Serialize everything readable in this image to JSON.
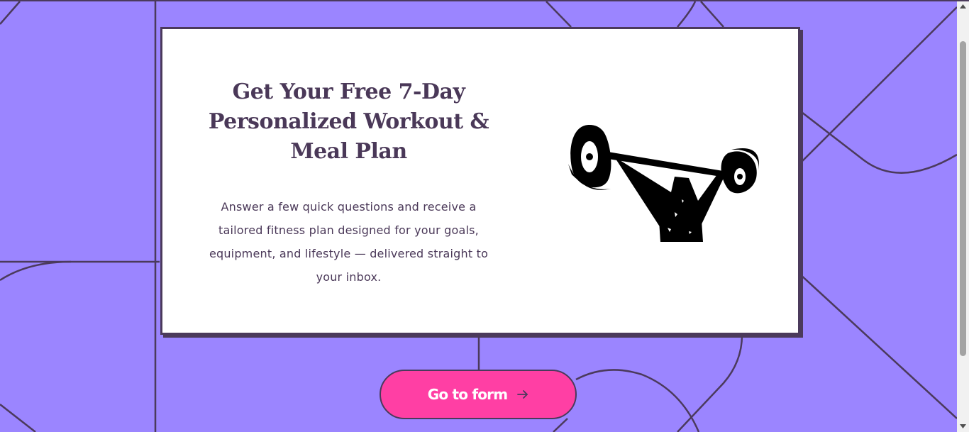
{
  "hero": {
    "headline": "Get Your Free 7-Day Personalized Workout & Meal Plan",
    "description": "Answer a few quick questions and receive a tailored fitness plan designed for your goals, equipment, and lifestyle — delivered straight to your inbox.",
    "illustration_icon": "weightlifter-icon"
  },
  "cta": {
    "label": "Go to form",
    "icon": "arrow-right-icon"
  },
  "colors": {
    "background": "#9b85ff",
    "line": "#4b3a5c",
    "card": "#ffffff",
    "text": "#4a3858",
    "button": "#ff3fa4",
    "button_text": "#ffffff"
  }
}
